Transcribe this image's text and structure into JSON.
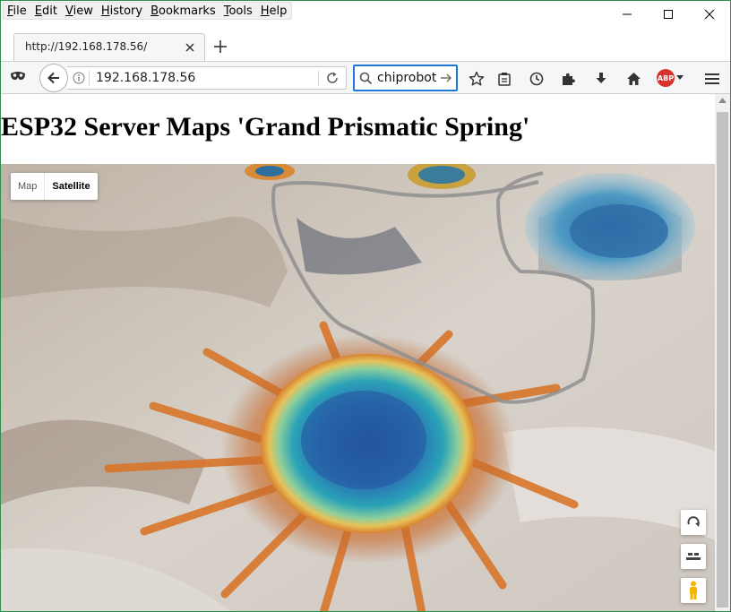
{
  "menu": [
    {
      "key": "F",
      "rest": "ile"
    },
    {
      "key": "E",
      "rest": "dit"
    },
    {
      "key": "V",
      "rest": "iew"
    },
    {
      "key": "H",
      "rest": "istory"
    },
    {
      "key": "B",
      "rest": "ookmarks"
    },
    {
      "key": "T",
      "rest": "ools"
    },
    {
      "key": "H",
      "rest": "elp"
    }
  ],
  "tab": {
    "title": "http://192.168.178.56/"
  },
  "navbar": {
    "url": "192.168.178.56",
    "search_value": "chiprobot",
    "adblock_label": "ABP"
  },
  "page": {
    "title": "ESP32 Server Maps 'Grand Prismatic Spring'"
  },
  "map": {
    "types": [
      "Map",
      "Satellite"
    ],
    "selected_type": "Satellite"
  },
  "colors": {
    "search_focus": "#1f78d6",
    "adblock": "#d6322e",
    "window_border": "#2f8f4e"
  }
}
